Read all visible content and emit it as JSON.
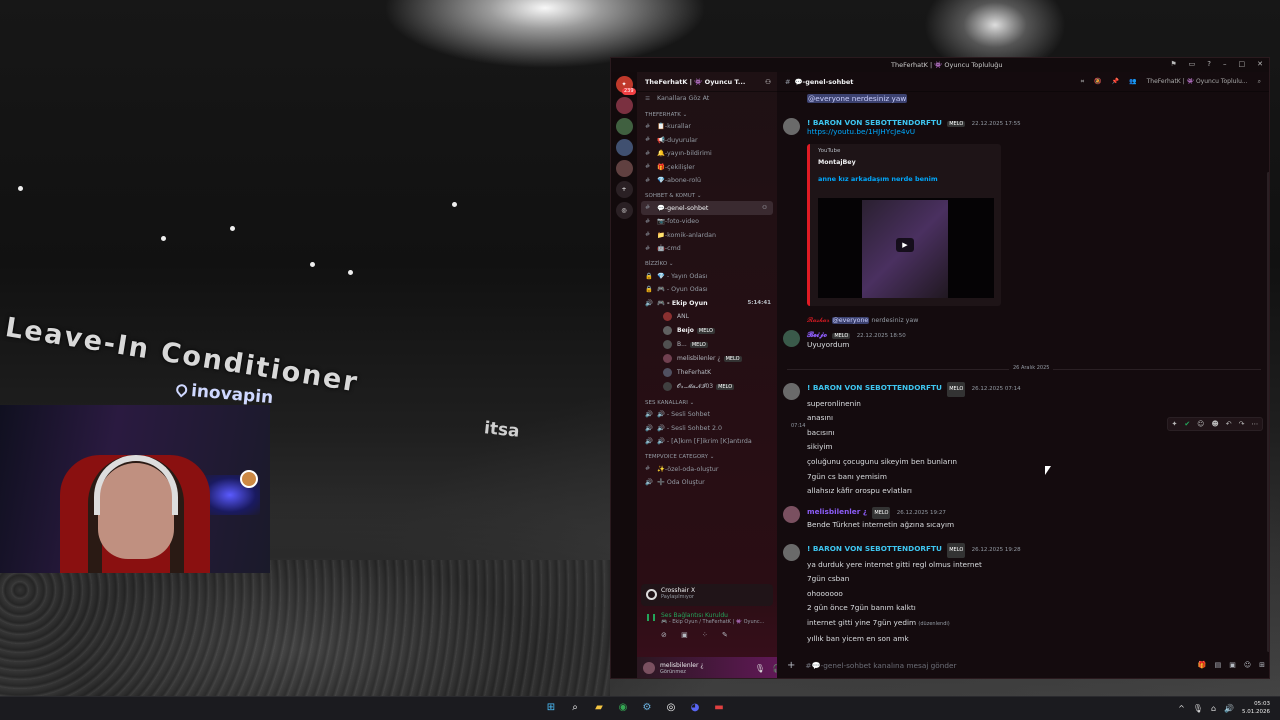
{
  "background": {
    "promo_text": "Leave-In Conditioner",
    "brand": "inovapin",
    "promo_side": "itsa"
  },
  "window": {
    "title": "TheFerhatK | 👾 Oyuncu Topluluğu"
  },
  "servers": {
    "badge": "239"
  },
  "sidebar": {
    "server_name": "TheFerhatK | 👾 Oyuncu T...",
    "browse_label": "Kanallara Göz At",
    "categories": [
      {
        "name": "THEFERHATK ⌄",
        "channels": [
          "📋-kurallar",
          "📢-duyurular",
          "🔔-yayın-bildirimi",
          "🎁-çekilişler",
          "💎-abone-rolü"
        ]
      },
      {
        "name": "SOHBET & KOMUT ⌄",
        "channels": [
          "💬-genel-sohbet",
          "📷-foto-video",
          "📁-komik-anlardan",
          "🤖-cmd"
        ]
      },
      {
        "name": "BİZZİKO ⌄",
        "channels": [
          "💎 - Yayın Odası",
          "🎮 - Oyun Odası",
          "🎮 - Ekip Oyun"
        ]
      }
    ],
    "active_channel": "💬-genel-sohbet",
    "voice_time": "5:14:41",
    "voice_users": [
      {
        "name": "ANL",
        "tag": ""
      },
      {
        "name": "Beıjo",
        "tag": "MELO"
      },
      {
        "name": "B...",
        "tag": "MELO"
      },
      {
        "name": "melisbilenler ¿",
        "tag": "MELO"
      },
      {
        "name": "TheFerhatK",
        "tag": ""
      },
      {
        "name": "𝓞𝓻.𝓜𝓪𝓝𝓘03",
        "tag": "MELO"
      }
    ],
    "voice_category": "SES KANALLARI ⌄",
    "voice_channels": [
      "🔊 - Sesli Sohbet",
      "🔊 - Sesli Sohbet 2.0",
      "🔊 - [A]kım [F]ikrim [K]antırda"
    ],
    "temp_category": "TEMPVOICE CATEGORY ⌄",
    "temp_channels": [
      "✨-özel-oda-oluştur",
      "➕ Oda Oluştur"
    ],
    "activity": {
      "title": "Crosshair X",
      "sub": "Paylaşılmıyor"
    },
    "voice_status": {
      "title": "Ses Bağlantısı Kuruldu",
      "sub": "🎮 - Ekip Oyun / TheFerhatK | 👾 Oyunc..."
    },
    "user": {
      "name": "melisbilenler ¿",
      "status": "Görünmez"
    }
  },
  "header": {
    "channel": "💬-genel-sohbet",
    "server_short": "TheFerhatK | 👾 Oyuncu Toplulu..."
  },
  "messages": {
    "m0_text": "@everyone nerdesiniz yaw",
    "m1_user": "! BARON VON SEBOTTENDORFTU",
    "m1_tag": "MELO",
    "m1_time": "22.12.2025 17:55",
    "m1_link": "https://youtu.be/1HJHYcJe4vU",
    "embed_provider": "YouTube",
    "embed_author": "MontajBey",
    "embed_title": "anne kız arkadaşım nerde benim",
    "reply_user": "𝓡𝓪𝓼𝓴𝓪𝓻",
    "reply_mention": "@everyone",
    "reply_text": "nerdesiniz yaw",
    "m2_user": "𝓑𝓮𝓲𝓳𝓸",
    "m2_tag": "MELO",
    "m2_time": "22.12.2025 18:50",
    "m2_text": "Uyuyordum",
    "date_divider": "26 Aralık 2025",
    "m3_user": "! BARON VON SEBOTTENDORFTU",
    "m3_tag": "MELO",
    "m3_time": "26.12.2025 07:14",
    "m3_lines": [
      "superonlinenin",
      "anasını",
      "bacısını",
      "sikiyim",
      "çoluğunu çocugunu sikeyim ben bunların",
      "7gün cs banı yemisim",
      "allahsız kâfir orospu evlatları"
    ],
    "hover_time": "07:14",
    "m4_user": "melisbilenler ¿",
    "m4_tag": "MELO",
    "m4_time": "26.12.2025 19:27",
    "m4_text": "Bende Türknet internetin ağzına sıcayım",
    "m5_user": "! BARON VON SEBOTTENDORFTU",
    "m5_tag": "MELO",
    "m5_time": "26.12.2025 19:28",
    "m5_lines": [
      "ya durduk yere internet gitti regl olmus internet",
      "7gün csban",
      "ohoooooo",
      "2 gün önce 7gün banım kalktı",
      "internet gitti yine 7gün yedim",
      "yıllık ban yicem en son amk"
    ],
    "edited": "(düzenlendi)"
  },
  "input": {
    "placeholder": "#💬-genel-sohbet kanalına mesaj gönder"
  },
  "taskbar": {
    "time": "05:03",
    "date": "5.01.2026"
  },
  "colors": {
    "accent_cyan": "#00a8fc",
    "username_cyan": "#3ec6f0",
    "username_purple": "#8b5cf6",
    "embed_bar": "#e01b24"
  }
}
